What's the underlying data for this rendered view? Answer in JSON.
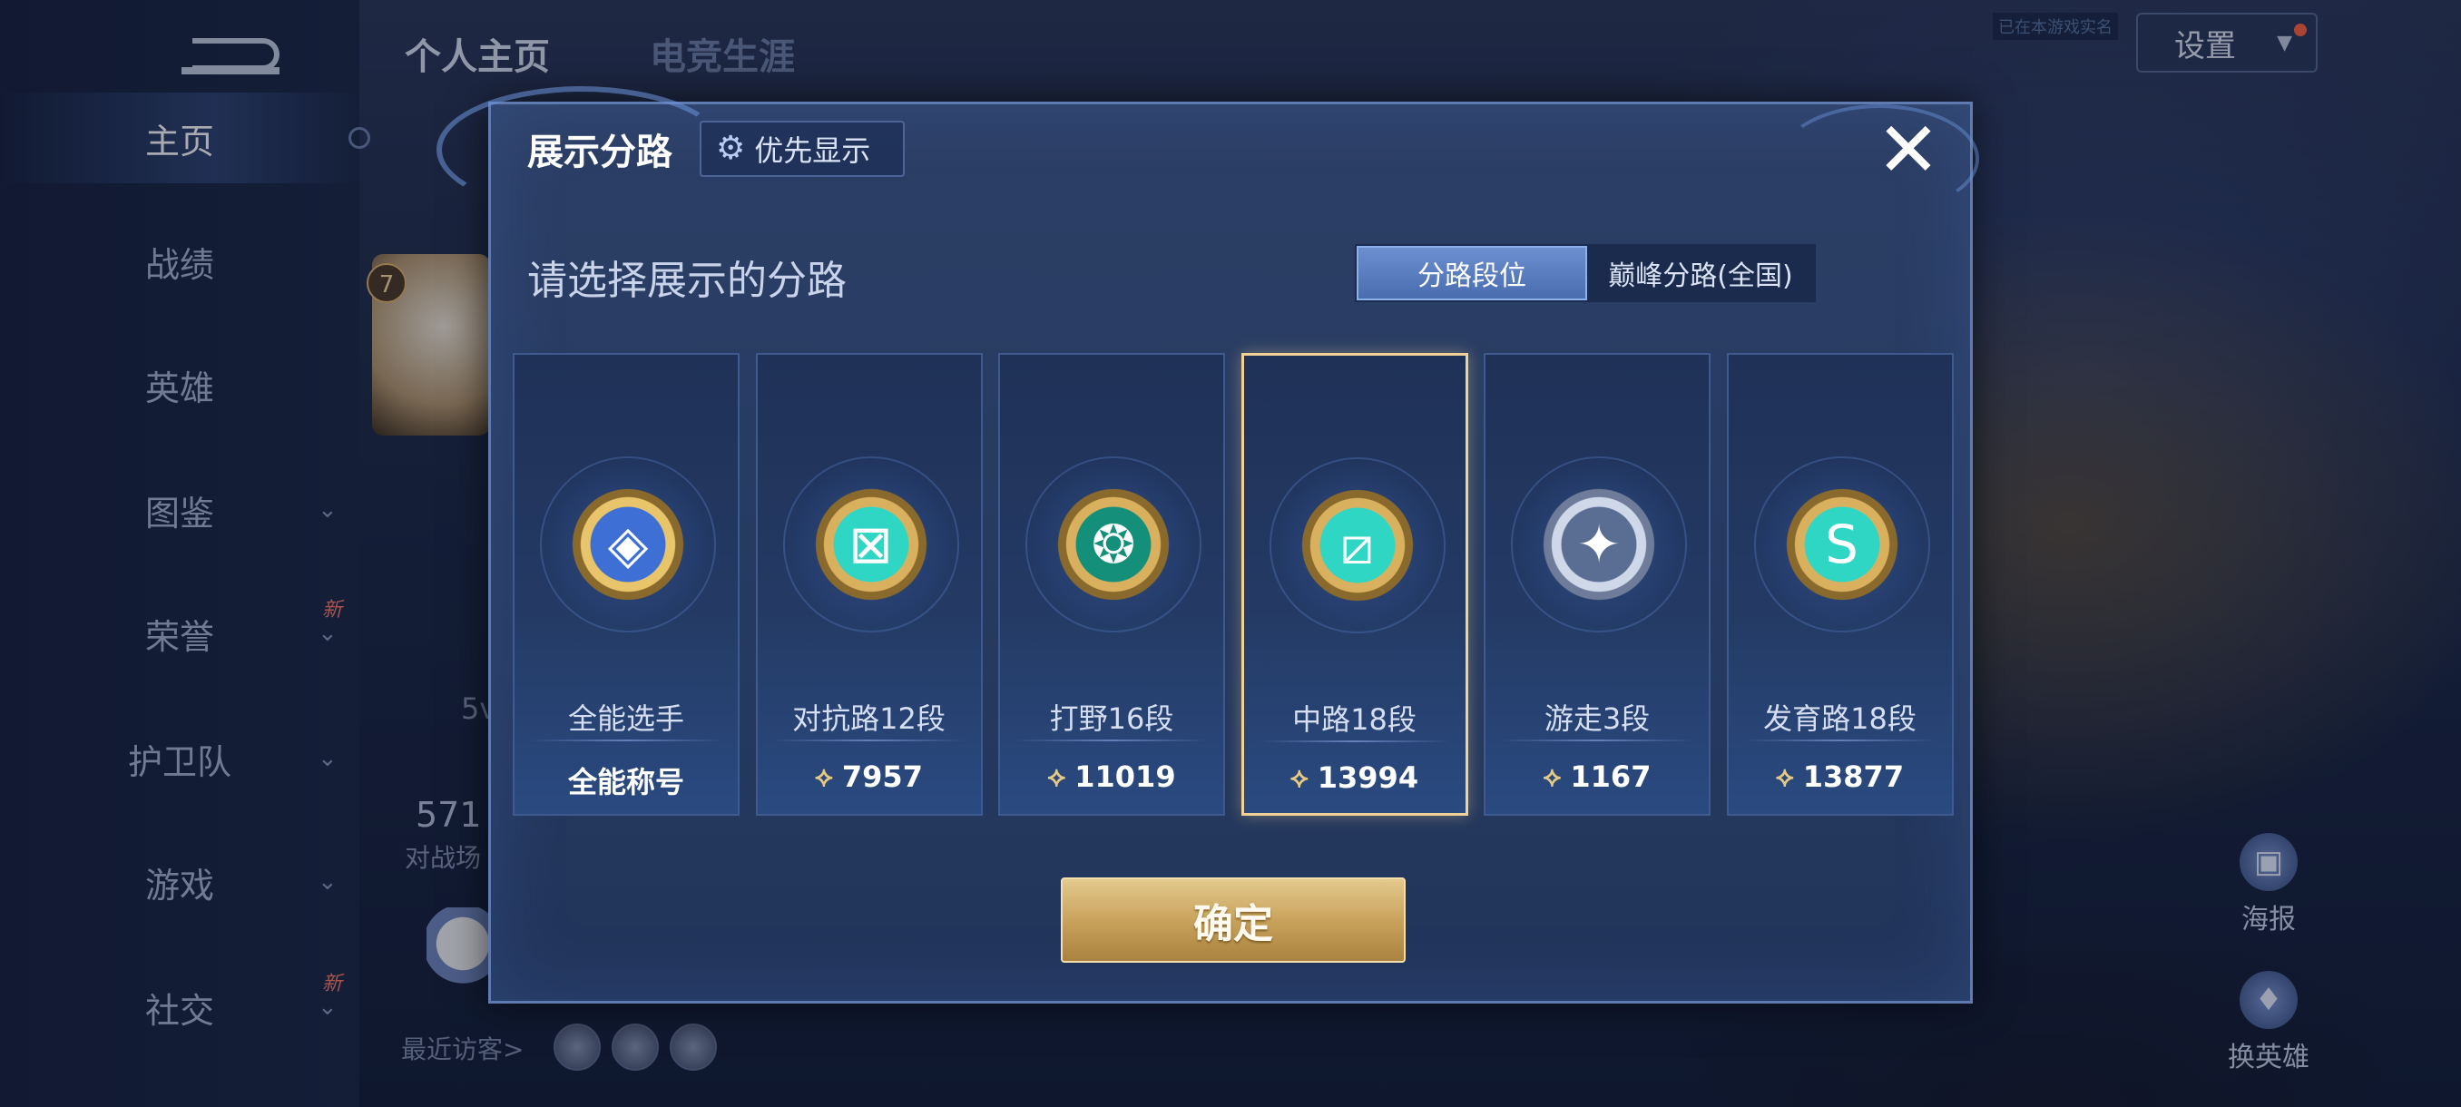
{
  "background": {
    "tabs": [
      "个人主页",
      "电竞生涯"
    ],
    "settings_label": "设置",
    "hidden_note": "已在本游戏实名",
    "level": "7",
    "stat_number": "571",
    "stat_label": "对战场",
    "side_text": "5v",
    "visitors_label": "最近访客>",
    "right_buttons": [
      {
        "icon": "poster-icon",
        "label": "海报"
      },
      {
        "icon": "swap-hero-icon",
        "label": "换英雄"
      }
    ]
  },
  "sidebar": {
    "items": [
      {
        "label": "主页",
        "active": true,
        "chevron": false,
        "new": ""
      },
      {
        "label": "战绩",
        "active": false,
        "chevron": false,
        "new": ""
      },
      {
        "label": "英雄",
        "active": false,
        "chevron": false,
        "new": ""
      },
      {
        "label": "图鉴",
        "active": false,
        "chevron": true,
        "new": ""
      },
      {
        "label": "荣誉",
        "active": false,
        "chevron": true,
        "new": "新"
      },
      {
        "label": "护卫队",
        "active": false,
        "chevron": true,
        "new": ""
      },
      {
        "label": "游戏",
        "active": false,
        "chevron": true,
        "new": ""
      },
      {
        "label": "社交",
        "active": false,
        "chevron": true,
        "new": "新"
      }
    ]
  },
  "modal": {
    "title": "展示分路",
    "priority_label": "优先显示",
    "close_symbol": "✕",
    "prompt": "请选择展示的分路",
    "segments": [
      {
        "label": "分路段位",
        "selected": true
      },
      {
        "label": "巅峰分路(全国)",
        "selected": false
      }
    ],
    "cards": [
      {
        "rank": "全能选手",
        "score": "全能称号",
        "emblem": "all-round-emblem-icon",
        "style": "blue",
        "glyph": "◈",
        "show_points": false,
        "selected": false
      },
      {
        "rank": "对抗路12段",
        "score": "7957",
        "emblem": "clash-lane-emblem-icon",
        "style": "gold",
        "glyph": "⊠",
        "show_points": true,
        "selected": false
      },
      {
        "rank": "打野16段",
        "score": "11019",
        "emblem": "jungle-emblem-icon",
        "style": "teal",
        "glyph": "❂",
        "show_points": true,
        "selected": false
      },
      {
        "rank": "中路18段",
        "score": "13994",
        "emblem": "mid-lane-emblem-icon",
        "style": "gold",
        "glyph": "⧄",
        "show_points": true,
        "selected": true
      },
      {
        "rank": "游走3段",
        "score": "1167",
        "emblem": "roam-emblem-icon",
        "style": "silver",
        "glyph": "✦",
        "show_points": true,
        "selected": false
      },
      {
        "rank": "发育路18段",
        "score": "13877",
        "emblem": "farm-lane-emblem-icon",
        "style": "gold",
        "glyph": "S",
        "show_points": true,
        "selected": false
      }
    ],
    "points_symbol": "⟡",
    "confirm_label": "确定"
  }
}
